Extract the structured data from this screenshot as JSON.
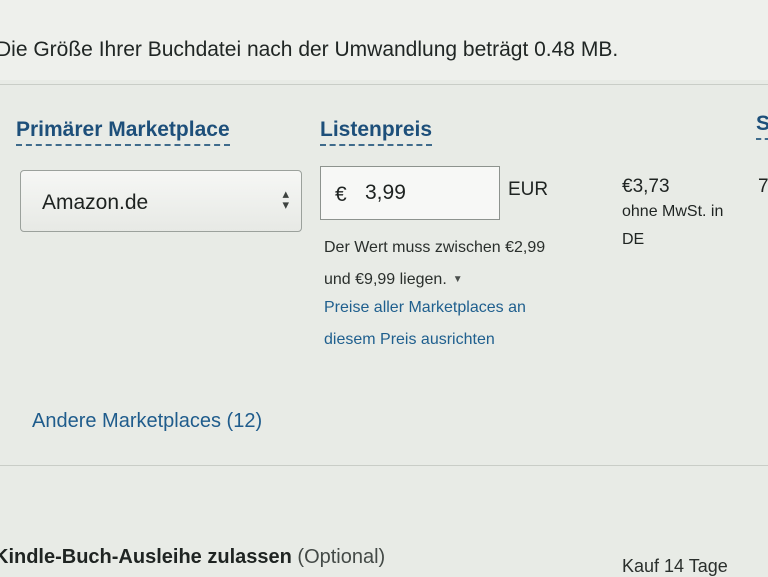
{
  "file_size_text": "Die Größe Ihrer Buchdatei nach der Umwandlung beträgt 0.48 MB.",
  "columns": {
    "marketplace": "Primärer Marketplace",
    "list_price": "Listenpreis",
    "cut_header": "S"
  },
  "marketplace_select": {
    "value": "Amazon.de"
  },
  "price": {
    "currency_symbol": "€",
    "value": "3,99",
    "unit": "EUR",
    "range_line1": "Der Wert muss zwischen €2,99",
    "range_line2": "und €9,99 liegen.",
    "align_link_line1": "Preise aller Marketplaces an",
    "align_link_line2": "diesem Preis ausrichten"
  },
  "royalty": {
    "amount": "€3,73",
    "note_line1": "ohne MwSt. in",
    "note_line2": "DE",
    "trailing": "7"
  },
  "other_marketplaces": "Andere Marketplaces (12)",
  "lending": {
    "label": "Kindle-Buch-Ausleihe zulassen",
    "optional": "(Optional)",
    "right_text": "Kauf 14 Tage"
  }
}
